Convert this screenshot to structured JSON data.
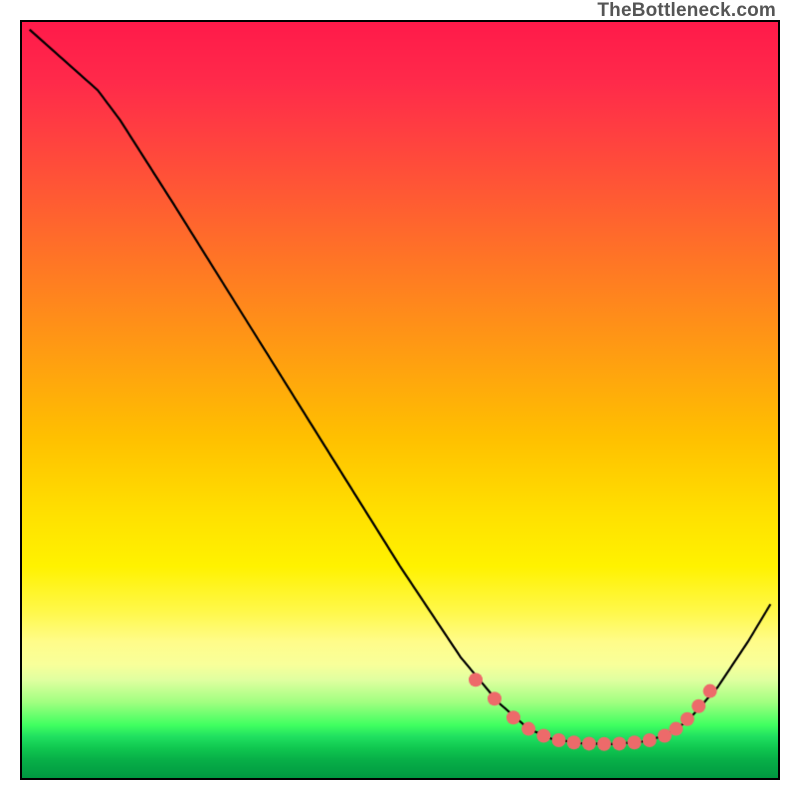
{
  "watermark": "TheBottleneck.com",
  "chart_data": {
    "type": "line",
    "title": "",
    "xlabel": "",
    "ylabel": "",
    "xlim": [
      0,
      100
    ],
    "ylim": [
      0,
      100
    ],
    "curve": [
      {
        "x": 1,
        "y": 99
      },
      {
        "x": 10,
        "y": 91
      },
      {
        "x": 13,
        "y": 87
      },
      {
        "x": 20,
        "y": 76
      },
      {
        "x": 30,
        "y": 60
      },
      {
        "x": 40,
        "y": 44
      },
      {
        "x": 50,
        "y": 28
      },
      {
        "x": 58,
        "y": 16
      },
      {
        "x": 63,
        "y": 10
      },
      {
        "x": 67,
        "y": 6.5
      },
      {
        "x": 70,
        "y": 5.2
      },
      {
        "x": 74,
        "y": 4.6
      },
      {
        "x": 78,
        "y": 4.5
      },
      {
        "x": 82,
        "y": 4.8
      },
      {
        "x": 85,
        "y": 5.6
      },
      {
        "x": 88,
        "y": 7.5
      },
      {
        "x": 92,
        "y": 12
      },
      {
        "x": 96,
        "y": 18
      },
      {
        "x": 99,
        "y": 23
      }
    ],
    "markers": [
      {
        "x": 60,
        "y": 13
      },
      {
        "x": 62.5,
        "y": 10.5
      },
      {
        "x": 65,
        "y": 8
      },
      {
        "x": 67,
        "y": 6.5
      },
      {
        "x": 69,
        "y": 5.6
      },
      {
        "x": 71,
        "y": 5.0
      },
      {
        "x": 73,
        "y": 4.7
      },
      {
        "x": 75,
        "y": 4.55
      },
      {
        "x": 77,
        "y": 4.5
      },
      {
        "x": 79,
        "y": 4.55
      },
      {
        "x": 81,
        "y": 4.7
      },
      {
        "x": 83,
        "y": 5.0
      },
      {
        "x": 85,
        "y": 5.6
      },
      {
        "x": 86.5,
        "y": 6.5
      },
      {
        "x": 88,
        "y": 7.8
      },
      {
        "x": 89.5,
        "y": 9.5
      },
      {
        "x": 91,
        "y": 11.5
      }
    ],
    "marker_color": "#ed6a6a",
    "curve_color": "#000000",
    "gradient_stops": [
      {
        "pos": 0,
        "color": "#ff1a4a"
      },
      {
        "pos": 50,
        "color": "#ffc000"
      },
      {
        "pos": 75,
        "color": "#fff84a"
      },
      {
        "pos": 90,
        "color": "#70ff70"
      },
      {
        "pos": 100,
        "color": "#009840"
      }
    ]
  }
}
